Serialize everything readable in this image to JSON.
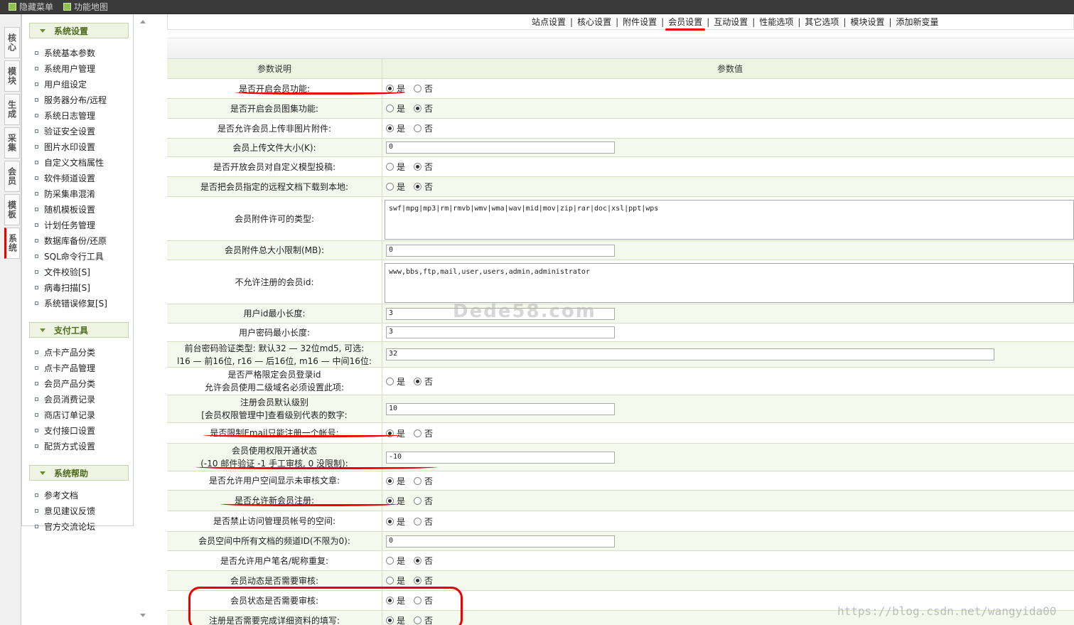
{
  "topbar": {
    "hide_menu": "隐藏菜单",
    "function_map": "功能地图"
  },
  "vtabs": [
    "核心",
    "模块",
    "生成",
    "采集",
    "会员",
    "模板",
    "系统"
  ],
  "menu": {
    "groups": [
      {
        "title": "系统设置",
        "items": [
          "系统基本参数",
          "系统用户管理",
          "用户组设定",
          "服务器分布/远程",
          "系统日志管理",
          "验证安全设置",
          "图片水印设置",
          "自定义文档属性",
          "软件频道设置",
          "防采集串混淆",
          "随机模板设置",
          "计划任务管理",
          "数据库备份/还原",
          "SQL命令行工具",
          "文件校验[S]",
          "病毒扫描[S]",
          "系统错误修复[S]"
        ]
      },
      {
        "title": "支付工具",
        "items": [
          "点卡产品分类",
          "点卡产品管理",
          "会员产品分类",
          "会员消费记录",
          "商店订单记录",
          "支付接口设置",
          "配货方式设置"
        ]
      },
      {
        "title": "系统帮助",
        "items": [
          "参考文档",
          "意见建议反馈",
          "官方交流论坛"
        ]
      }
    ]
  },
  "tabs": [
    "站点设置",
    "核心设置",
    "附件设置",
    "会员设置",
    "互动设置",
    "性能选项",
    "其它选项",
    "模块设置",
    "添加新变量"
  ],
  "table": {
    "head": {
      "label": "参数说明",
      "value": "参数值"
    },
    "yes": "是",
    "no": "否",
    "rows": [
      {
        "label": "是否开启会员功能:",
        "type": "radio",
        "sel": "yes"
      },
      {
        "label": "是否开启会员图集功能:",
        "type": "radio",
        "sel": "no"
      },
      {
        "label": "是否允许会员上传非图片附件:",
        "type": "radio",
        "sel": "yes"
      },
      {
        "label": "会员上传文件大小(K):",
        "type": "text",
        "value": "0"
      },
      {
        "label": "是否开放会员对自定义模型投稿:",
        "type": "radio",
        "sel": "no"
      },
      {
        "label": "是否把会员指定的远程文档下载到本地:",
        "type": "radio",
        "sel": "no"
      },
      {
        "label": "会员附件许可的类型:",
        "type": "area",
        "value": "swf|mpg|mp3|rm|rmvb|wmv|wma|wav|mid|mov|zip|rar|doc|xsl|ppt|wps"
      },
      {
        "label": "会员附件总大小限制(MB):",
        "type": "text",
        "value": "0"
      },
      {
        "label": "不允许注册的会员id:",
        "type": "area",
        "value": "www,bbs,ftp,mail,user,users,admin,administrator"
      },
      {
        "label": "用户id最小长度:",
        "type": "text",
        "value": "3"
      },
      {
        "label": "用户密码最小长度:",
        "type": "text",
        "value": "3"
      },
      {
        "label": "前台密码验证类型: 默认32 — 32位md5, 可选:\nl16 — 前16位, r16 — 后16位, m16 — 中间16位:",
        "type": "textwide",
        "value": "32"
      },
      {
        "label": "是否严格限定会员登录id\n允许会员使用二级域名必须设置此项:",
        "type": "radio",
        "sel": "no"
      },
      {
        "label": "注册会员默认级别\n[会员权限管理中]查看级别代表的数字:",
        "type": "text",
        "value": "10"
      },
      {
        "label": "是否限制Email只能注册一个帐号:",
        "type": "radio",
        "sel": "yes"
      },
      {
        "label": "会员使用权限开通状态\n(-10 邮件验证 -1 手工审核, 0 没限制):",
        "type": "text",
        "value": "-10"
      },
      {
        "label": "是否允许用户空间显示未审核文章:",
        "type": "radio",
        "sel": "yes"
      },
      {
        "label": "是否允许新会员注册:",
        "type": "radio",
        "sel": "yes"
      },
      {
        "label": "是否禁止访问管理员帐号的空间:",
        "type": "radio",
        "sel": "yes"
      },
      {
        "label": "会员空间中所有文档的频道ID(不限为0):",
        "type": "text",
        "value": "0"
      },
      {
        "label": "是否允许用户笔名/昵称重复:",
        "type": "radio",
        "sel": "no"
      },
      {
        "label": "会员动态是否需要审核:",
        "type": "radio",
        "sel": "no"
      },
      {
        "label": "会员状态是否需要审核:",
        "type": "radio",
        "sel": "yes"
      },
      {
        "label": "注册是否需要完成详细资料的填写:",
        "type": "radio",
        "sel": "yes"
      }
    ]
  },
  "watermark": "Dede58.com",
  "credit": "https://blog.csdn.net/wangyida00",
  "colors": {
    "accent_green": "#eef3e2",
    "annotation_red": "#e00"
  }
}
